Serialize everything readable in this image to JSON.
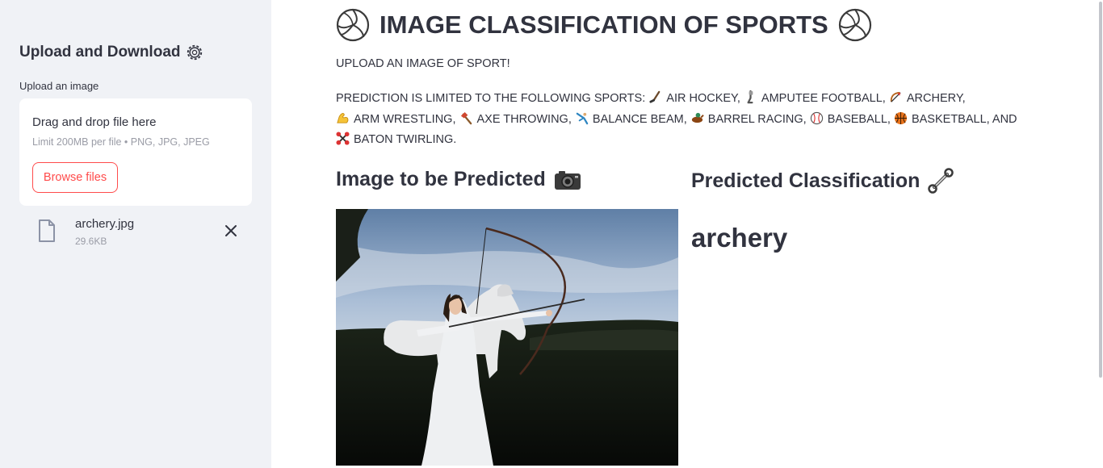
{
  "sidebar": {
    "title": "Upload and Download",
    "title_icon": "gear-icon",
    "upload_label": "Upload an image",
    "dropzone": {
      "text": "Drag and drop file here",
      "limit": "Limit 200MB per file • PNG, JPG, JPEG",
      "browse_label": "Browse files"
    },
    "file": {
      "name": "archery.jpg",
      "size": "29.6KB",
      "icon": "file-icon"
    }
  },
  "main": {
    "title": "IMAGE CLASSIFICATION OF SPORTS",
    "title_icon": "volleyball-icon",
    "intro": "UPLOAD AN IMAGE OF SPORT!",
    "prediction_prefix": "PREDICTION IS LIMITED TO THE FOLLOWING SPORTS:",
    "sports": [
      {
        "label": "AIR HOCKEY,",
        "icon": "hockey-stick-icon"
      },
      {
        "label": "AMPUTEE FOOTBALL,",
        "icon": "prosthetic-leg-icon"
      },
      {
        "label": "ARCHERY,",
        "icon": "bow-and-arrow-icon"
      },
      {
        "label": "ARM WRESTLING,",
        "icon": "flexed-biceps-icon"
      },
      {
        "label": "AXE THROWING,",
        "icon": "axe-icon"
      },
      {
        "label": "BALANCE BEAM,",
        "icon": "cartwheel-icon"
      },
      {
        "label": "BARREL RACING,",
        "icon": "horse-racing-icon"
      },
      {
        "label": "BASEBALL,",
        "icon": "baseball-icon"
      },
      {
        "label": "BASKETBALL, AND",
        "icon": "basketball-icon"
      },
      {
        "label": "BATON TWIRLING.",
        "icon": "baton-icon"
      }
    ],
    "image_heading": "Image to be Predicted",
    "image_heading_icon": "camera-icon",
    "prediction_heading": "Predicted Classification",
    "prediction_heading_icon": "wrench-icon",
    "prediction_result": "archery",
    "photo_icon": "archery-photo"
  },
  "colors": {
    "accent": "#ff4b4b",
    "sidebar_bg": "#f0f2f6",
    "text": "#31333f",
    "muted": "#9a9ca6"
  }
}
